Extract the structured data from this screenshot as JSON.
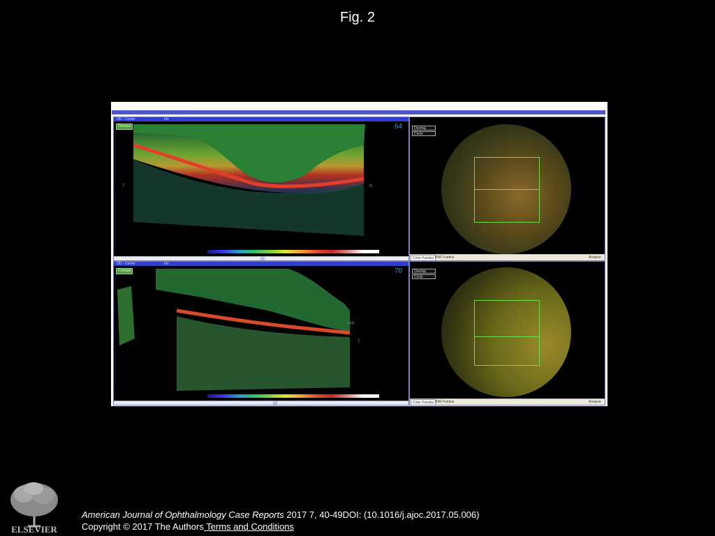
{
  "figure": {
    "title": "Fig. 2"
  },
  "panels": {
    "top": {
      "window_title": "OD - Center",
      "window_subtitle": "Idx",
      "mode_button": "Colorpal",
      "scan_number": "64",
      "left_letter": "T",
      "right_letter": "N",
      "fundus": {
        "overlay_button": "Overlay",
        "circle_button": "Circle",
        "tabs": [
          "Color Fundus",
          "B/W Fundus"
        ],
        "analyze_label": "Analyze"
      }
    },
    "bottom": {
      "window_title": "OD - Center",
      "window_subtitle": "Idx",
      "mode_button": "Colorpal",
      "scan_number": "70",
      "right_letter": "T",
      "marker_label": "+45",
      "fundus": {
        "overlay_button": "Overlay",
        "circle_button": "Circle",
        "tabs": [
          "Color Fundus",
          "B/W Fundus"
        ],
        "analyze_label": "Analyze"
      }
    }
  },
  "footer": {
    "publisher_logo_text": "ELSEVIER",
    "journal": "American Journal of Ophthalmology Case Reports",
    "citation_rest": " 2017 7, 40-49DOI: (10.1016/j.ajoc.2017.05.006)",
    "copyright": "Copyright © 2017 The Authors",
    "terms_link": " Terms and Conditions"
  },
  "colors": {
    "background": "#000000",
    "title_bar": "#2f3fcf",
    "grid_box": "#6fdc4f",
    "scan_number": "#3a9bd0"
  }
}
